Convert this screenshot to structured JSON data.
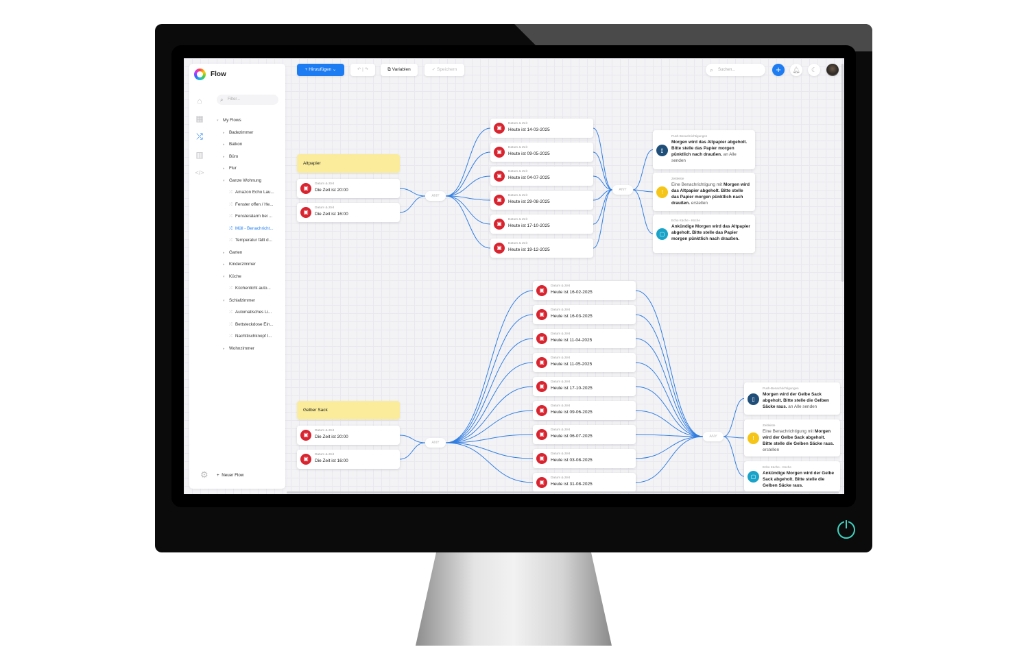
{
  "app": {
    "title": "Flow",
    "accent": "#1e7cf2"
  },
  "toolbar": {
    "add_label": "+ Hinzufügen ⌄",
    "undo_icon": "undo-icon",
    "redo_icon": "redo-icon",
    "variables_label": "Variablen",
    "save_label": "✓ Speichern",
    "search_placeholder": "Suchen..."
  },
  "sidebar": {
    "filter_placeholder": "Filter...",
    "root": "My Flows",
    "new_flow": "Neuer Flow",
    "items": [
      {
        "label": "Badezimmer",
        "type": "folder"
      },
      {
        "label": "Balkon",
        "type": "folder"
      },
      {
        "label": "Büro",
        "type": "folder"
      },
      {
        "label": "Flur",
        "type": "folder"
      },
      {
        "label": "Ganze Wohnung",
        "type": "folder-open"
      },
      {
        "label": "Amazon Echo Lau...",
        "type": "flow"
      },
      {
        "label": "Fenster offen / He...",
        "type": "flow"
      },
      {
        "label": "Fensteralarm bei ...",
        "type": "flow"
      },
      {
        "label": "Müll - Benachricht...",
        "type": "flow",
        "selected": true
      },
      {
        "label": "Temperatur fällt d...",
        "type": "flow"
      },
      {
        "label": "Garten",
        "type": "folder"
      },
      {
        "label": "Kinderzimmer",
        "type": "folder"
      },
      {
        "label": "Küche",
        "type": "folder-open"
      },
      {
        "label": "Küchenlicht auto...",
        "type": "flow"
      },
      {
        "label": "Schlafzimmer",
        "type": "folder-open"
      },
      {
        "label": "Automatisches Li...",
        "type": "flow"
      },
      {
        "label": "Bettsteckdose Ein...",
        "type": "flow"
      },
      {
        "label": "Nachttischknopf I...",
        "type": "flow"
      },
      {
        "label": "Wohnzimmer",
        "type": "folder"
      }
    ]
  },
  "flows": [
    {
      "note": "Altpapier",
      "any_label": "ANY",
      "card_kind": "Datum & Zeit",
      "times": [
        "Die Zeit ist 20:00",
        "Die Zeit ist 16:00"
      ],
      "dates": [
        "Heute ist 14-03-2025",
        "Heute ist 09-05-2025",
        "Heute ist 04-07-2025",
        "Heute ist 29-08-2025",
        "Heute ist 17-10-2025",
        "Heute ist 19-12-2025"
      ],
      "actions": [
        {
          "kind": "Push Benachrichtigungen",
          "text": "Morgen wird das Altpapier abgeholt. Bitte stelle das Papier morgen pünktlich nach draußen.",
          "suffix": " an Alle senden",
          "color": "#1f4e79",
          "icon": "phone-icon"
        },
        {
          "kind": "Zeitleiste",
          "prefix": "Eine Benachrichtigung mit ",
          "text": "Morgen wird das Altpapier abgeholt. Bitte stelle das Papier morgen pünktlich nach draußen.",
          "suffix": " erstellen",
          "color": "#f5c518",
          "icon": "timeline-icon"
        },
        {
          "kind": "Echo Küche - Küche",
          "text": "Ankündige  Morgen wird das Altpapier abgeholt. Bitte stelle das Papier morgen pünktlich nach draußen.",
          "color": "#1aa3c8",
          "icon": "speaker-icon"
        }
      ]
    },
    {
      "note": "Gelber Sack",
      "any_label": "ANY",
      "card_kind": "Datum & Zeit",
      "times": [
        "Die Zeit ist 20:00",
        "Die Zeit ist 16:00"
      ],
      "dates": [
        "Heute ist 16-02-2025",
        "Heute ist 16-03-2025",
        "Heute ist 11-04-2025",
        "Heute ist 11-05-2025",
        "Heute ist 17-10-2025",
        "Heute ist 09-06-2025",
        "Heute ist 06-07-2025",
        "Heute ist 03-08-2025",
        "Heute ist 31-08-2025"
      ],
      "actions": [
        {
          "kind": "Push-Benachrichtigungen",
          "text": "Morgen wird der Gelbe Sack abgeholt. Bitte stelle die Gelben Säcke raus.",
          "suffix": "  an Alle senden",
          "color": "#1f4e79",
          "icon": "phone-icon"
        },
        {
          "kind": "Zeitleiste",
          "prefix": "Eine Benachrichtigung mit ",
          "text": "Morgen wird der Gelbe Sack abgeholt. Bitte stelle die Gelben Säcke raus.",
          "suffix": " erstellen",
          "color": "#f5c518",
          "icon": "timeline-icon"
        },
        {
          "kind": "Echo Küche - Küche",
          "text": "Ankündige  Morgen wird der Gelbe Sack abgeholt. Bitte stelle die Gelben Säcke raus.",
          "color": "#1aa3c8",
          "icon": "speaker-icon"
        }
      ]
    }
  ]
}
